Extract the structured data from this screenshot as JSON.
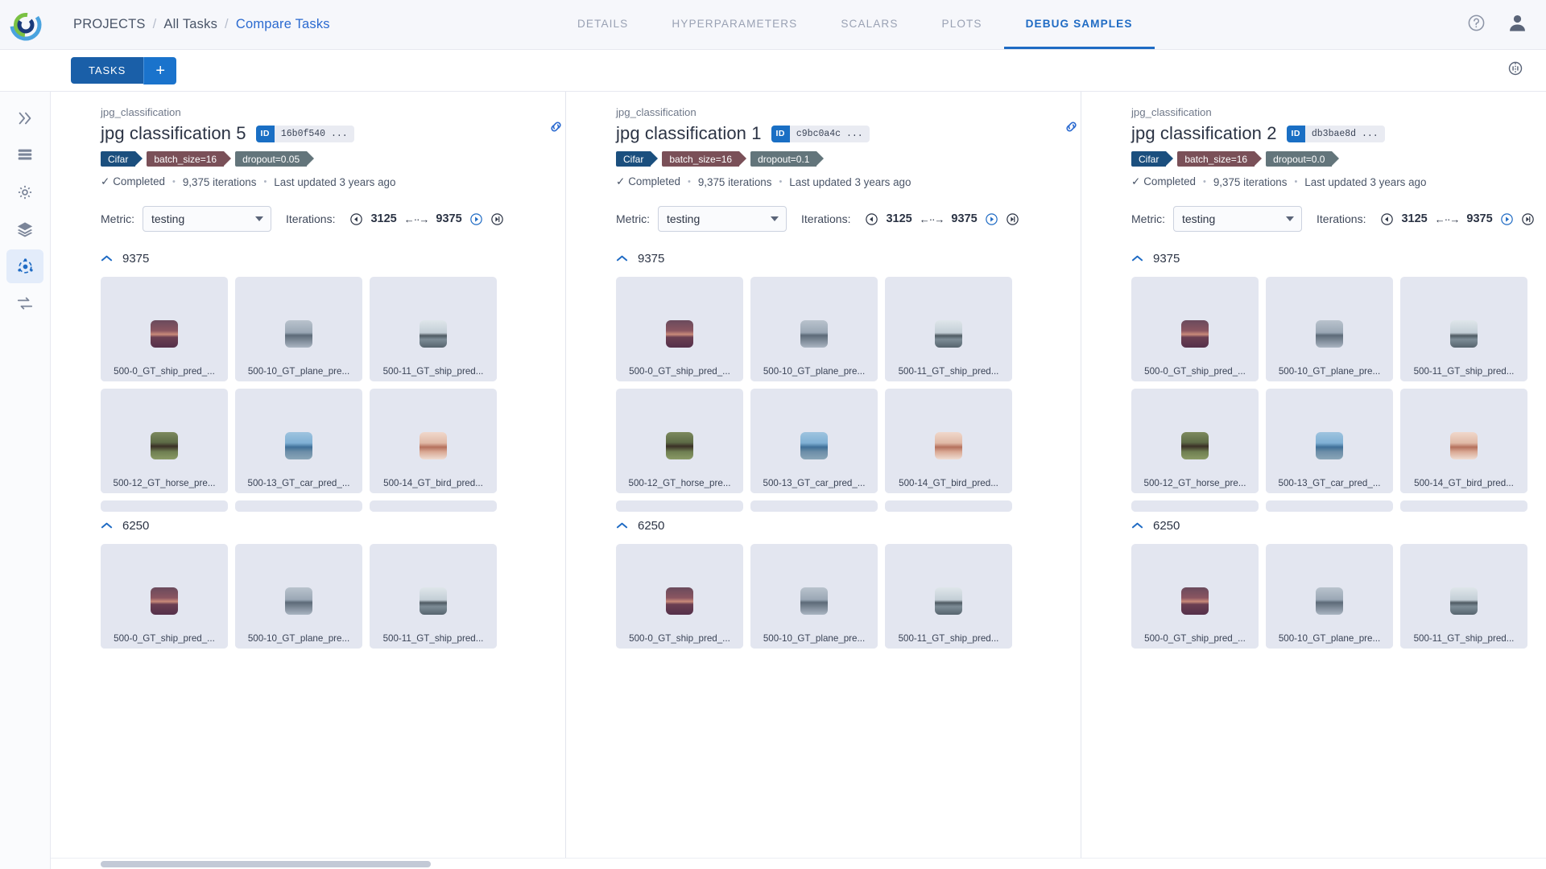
{
  "header": {
    "logo": "clearml-logo",
    "breadcrumb": [
      {
        "label": "PROJECTS",
        "active": false
      },
      {
        "label": "All Tasks",
        "active": false
      },
      {
        "label": "Compare Tasks",
        "active": true
      }
    ],
    "separator": "/",
    "tabs": [
      {
        "label": "DETAILS",
        "active": false
      },
      {
        "label": "HYPERPARAMETERS",
        "active": false
      },
      {
        "label": "SCALARS",
        "active": false
      },
      {
        "label": "PLOTS",
        "active": false
      },
      {
        "label": "DEBUG SAMPLES",
        "active": true
      }
    ],
    "help_icon": "help-circle-icon",
    "avatar_icon": "user-avatar-icon"
  },
  "toolbar": {
    "tasks_label": "TASKS",
    "add_label": "+",
    "right_icon": "compare-settings-icon"
  },
  "sidebar": {
    "items": [
      {
        "icon": "pipelines-icon",
        "active": false
      },
      {
        "icon": "datasets-icon",
        "active": false
      },
      {
        "icon": "hyperdatasets-icon",
        "active": false
      },
      {
        "icon": "layers-icon",
        "active": false
      },
      {
        "icon": "experiments-icon",
        "active": true
      },
      {
        "icon": "compare-icon",
        "active": false
      }
    ]
  },
  "link_icon": "link-columns-icon",
  "columns": [
    {
      "project": "jpg_classification",
      "title": "jpg classification 5",
      "id_label": "ID",
      "id_value": "16b0f540 ...",
      "tags": [
        {
          "text": "Cifar",
          "color": "#1b4f7e"
        },
        {
          "text": "batch_size=16",
          "color": "#7a5058"
        },
        {
          "text": "dropout=0.05",
          "color": "#63757b"
        }
      ],
      "status": "Completed",
      "iterations_text": "9,375 iterations",
      "updated": "Last updated 3 years ago",
      "metric_label": "Metric:",
      "metric_value": "testing",
      "iterations_label": "Iterations:",
      "iter_from": "3125",
      "iter_to": "9375",
      "groups": [
        {
          "title": "9375",
          "tiles": [
            {
              "caption": "500-0_GT_ship_pred_...",
              "thumb": "ship"
            },
            {
              "caption": "500-10_GT_plane_pre...",
              "thumb": "plane"
            },
            {
              "caption": "500-11_GT_ship_pred...",
              "thumb": "ship2"
            },
            {
              "caption": "500-12_GT_horse_pre...",
              "thumb": "horse"
            },
            {
              "caption": "500-13_GT_car_pred_...",
              "thumb": "car"
            },
            {
              "caption": "500-14_GT_bird_pred...",
              "thumb": "bird"
            }
          ]
        },
        {
          "title": "6250",
          "tiles": [
            {
              "caption": "500-0_GT_ship_pred_...",
              "thumb": "ship"
            },
            {
              "caption": "500-10_GT_plane_pre...",
              "thumb": "plane"
            },
            {
              "caption": "500-11_GT_ship_pred...",
              "thumb": "ship2"
            }
          ]
        }
      ]
    },
    {
      "project": "jpg_classification",
      "title": "jpg classification 1",
      "id_label": "ID",
      "id_value": "c9bc0a4c ...",
      "tags": [
        {
          "text": "Cifar",
          "color": "#1b4f7e"
        },
        {
          "text": "batch_size=16",
          "color": "#7a5058"
        },
        {
          "text": "dropout=0.1",
          "color": "#63757b"
        }
      ],
      "status": "Completed",
      "iterations_text": "9,375 iterations",
      "updated": "Last updated 3 years ago",
      "metric_label": "Metric:",
      "metric_value": "testing",
      "iterations_label": "Iterations:",
      "iter_from": "3125",
      "iter_to": "9375",
      "groups": [
        {
          "title": "9375",
          "tiles": [
            {
              "caption": "500-0_GT_ship_pred_...",
              "thumb": "ship"
            },
            {
              "caption": "500-10_GT_plane_pre...",
              "thumb": "plane"
            },
            {
              "caption": "500-11_GT_ship_pred...",
              "thumb": "ship2"
            },
            {
              "caption": "500-12_GT_horse_pre...",
              "thumb": "horse"
            },
            {
              "caption": "500-13_GT_car_pred_...",
              "thumb": "car"
            },
            {
              "caption": "500-14_GT_bird_pred...",
              "thumb": "bird"
            }
          ]
        },
        {
          "title": "6250",
          "tiles": [
            {
              "caption": "500-0_GT_ship_pred_...",
              "thumb": "ship"
            },
            {
              "caption": "500-10_GT_plane_pre...",
              "thumb": "plane"
            },
            {
              "caption": "500-11_GT_ship_pred...",
              "thumb": "ship2"
            }
          ]
        }
      ]
    },
    {
      "project": "jpg_classification",
      "title": "jpg classification 2",
      "id_label": "ID",
      "id_value": "db3bae8d ...",
      "tags": [
        {
          "text": "Cifar",
          "color": "#1b4f7e"
        },
        {
          "text": "batch_size=16",
          "color": "#7a5058"
        },
        {
          "text": "dropout=0.0",
          "color": "#63757b"
        }
      ],
      "status": "Completed",
      "iterations_text": "9,375 iterations",
      "updated": "Last updated 3 years ago",
      "metric_label": "Metric:",
      "metric_value": "testing",
      "iterations_label": "Iterations:",
      "iter_from": "3125",
      "iter_to": "9375",
      "groups": [
        {
          "title": "9375",
          "tiles": [
            {
              "caption": "500-0_GT_ship_pred_...",
              "thumb": "ship"
            },
            {
              "caption": "500-10_GT_plane_pre...",
              "thumb": "plane"
            },
            {
              "caption": "500-11_GT_ship_pred...",
              "thumb": "ship2"
            },
            {
              "caption": "500-12_GT_horse_pre...",
              "thumb": "horse"
            },
            {
              "caption": "500-13_GT_car_pred_...",
              "thumb": "car"
            },
            {
              "caption": "500-14_GT_bird_pred...",
              "thumb": "bird"
            }
          ]
        },
        {
          "title": "6250",
          "tiles": [
            {
              "caption": "500-0_GT_ship_pred_...",
              "thumb": "ship"
            },
            {
              "caption": "500-10_GT_plane_pre...",
              "thumb": "plane"
            },
            {
              "caption": "500-11_GT_ship_pred...",
              "thumb": "ship2"
            }
          ]
        }
      ]
    }
  ]
}
